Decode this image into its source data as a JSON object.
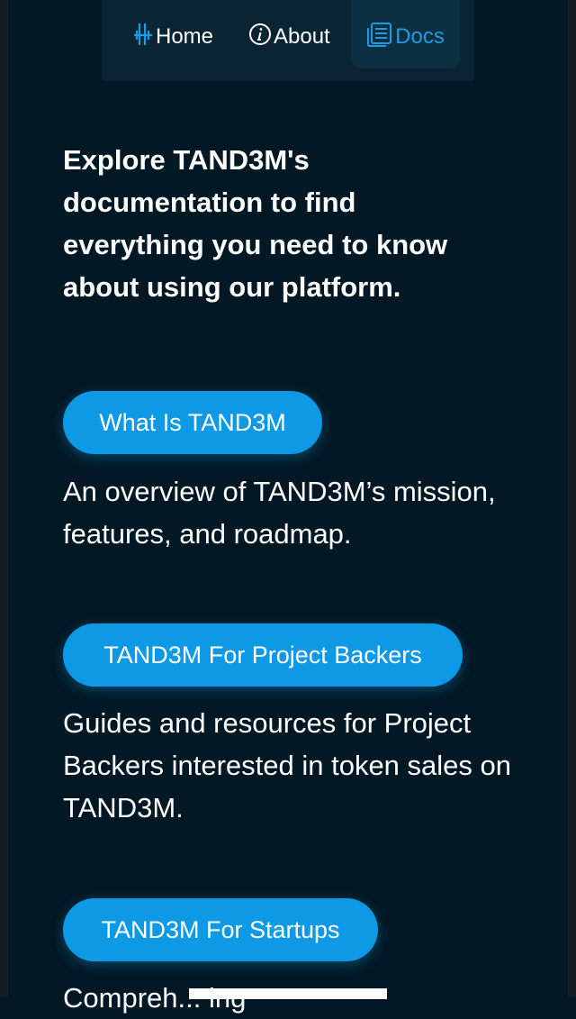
{
  "nav": {
    "home_label": "Home",
    "about_label": "About",
    "docs_label": "Docs",
    "active": "Docs"
  },
  "intro": "Explore TAND3M's documentation to find everything you need to know about using our platform.",
  "sections": [
    {
      "button": "What Is TAND3M",
      "description": "An overview of TAND3M’s mission, features, and roadmap."
    },
    {
      "button": "TAND3M For Project Backers",
      "description": "Guides and resources for Project Backers interested in token sales on TAND3M."
    },
    {
      "button": "TAND3M For Startups",
      "description": "Compreh... ing"
    }
  ],
  "colors": {
    "background": "#021824",
    "accent": "#0e99e6",
    "nav_active": "#1d9be6"
  }
}
